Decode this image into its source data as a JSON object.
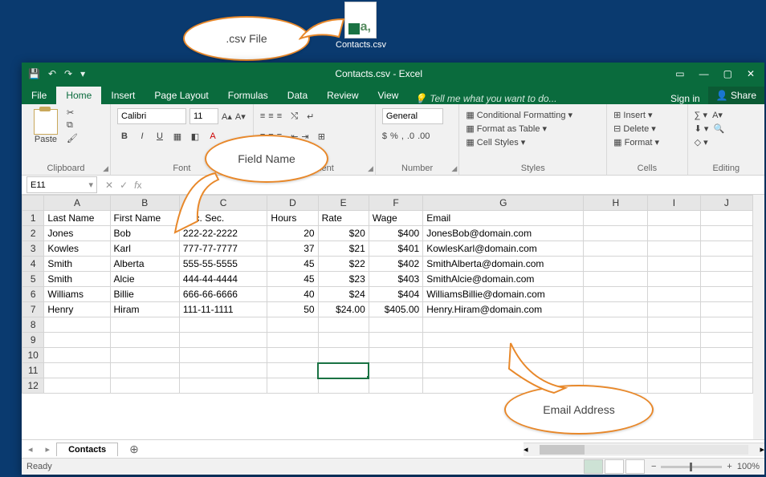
{
  "desktop": {
    "icon_label": "Contacts.csv"
  },
  "callouts": {
    "csv_file": ".csv File",
    "field_name": "Field Name",
    "email": "Email Address"
  },
  "titlebar": {
    "title": "Contacts.csv - Excel"
  },
  "win_buttons": {
    "ribbon_opts": "▭",
    "min": "—",
    "max": "▢",
    "close": "✕"
  },
  "tabs": {
    "file": "File",
    "home": "Home",
    "insert": "Insert",
    "page_layout": "Page Layout",
    "formulas": "Formulas",
    "data": "Data",
    "review": "Review",
    "view": "View"
  },
  "tell_me": "Tell me what you want to do...",
  "signin": "Sign in",
  "share": "Share",
  "ribbon": {
    "clipboard": {
      "paste": "Paste",
      "label": "Clipboard"
    },
    "font": {
      "name": "Calibri",
      "size": "11",
      "bold": "B",
      "italic": "I",
      "underline": "U",
      "label": "Font"
    },
    "alignment": {
      "label": "Alignment"
    },
    "number": {
      "general": "General",
      "label": "Number"
    },
    "styles": {
      "cf": "Conditional Formatting",
      "fat": "Format as Table",
      "cs": "Cell Styles",
      "label": "Styles"
    },
    "cells": {
      "insert": "Insert",
      "delete": "Delete",
      "format": "Format",
      "label": "Cells"
    },
    "editing": {
      "label": "Editing"
    }
  },
  "namebox": "E11",
  "chart_data": {
    "type": "table",
    "columns": [
      "A",
      "B",
      "C",
      "D",
      "E",
      "F",
      "G",
      "H",
      "I",
      "J"
    ],
    "headers": [
      "Last Name",
      "First Name",
      "Soc. Sec.",
      "Hours",
      "Rate",
      "Wage",
      "Email"
    ],
    "rows": [
      [
        "Jones",
        "Bob",
        "222-22-2222",
        "20",
        "$20",
        "$400",
        "JonesBob@domain.com"
      ],
      [
        "Kowles",
        "Karl",
        "777-77-7777",
        "37",
        "$21",
        "$401",
        "KowlesKarl@domain.com"
      ],
      [
        "Smith",
        "Alberta",
        "555-55-5555",
        "45",
        "$22",
        "$402",
        "SmithAlberta@domain.com"
      ],
      [
        "Smith",
        "Alcie",
        "444-44-4444",
        "45",
        "$23",
        "$403",
        "SmithAlcie@domain.com"
      ],
      [
        "Williams",
        "Billie",
        "666-66-6666",
        "40",
        "$24",
        "$404",
        "WilliamsBillie@domain.com"
      ],
      [
        "Henry",
        "Hiram",
        "111-11-1111",
        "50",
        "$24.00",
        "$405.00",
        "Henry.Hiram@domain.com"
      ]
    ],
    "selected_cell": "E11"
  },
  "sheet_tab": "Contacts",
  "status": {
    "ready": "Ready",
    "zoom": "100%"
  }
}
